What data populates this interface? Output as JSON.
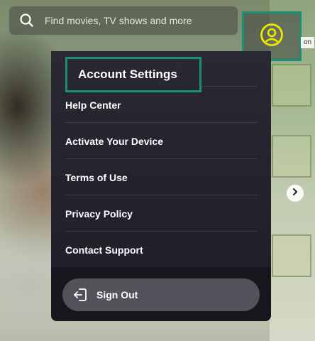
{
  "search": {
    "placeholder": "Find movies, TV shows and more",
    "icon": "search-icon"
  },
  "profile": {
    "icon": "user-circle-icon",
    "accent_color": "#f2e600",
    "focus_color": "#1a8f74"
  },
  "hover_tag": "on",
  "menu": {
    "header_label": "Account Settings",
    "items": [
      {
        "label": "Help Center"
      },
      {
        "label": "Activate Your Device"
      },
      {
        "label": "Terms of Use"
      },
      {
        "label": "Privacy Policy"
      },
      {
        "label": "Contact Support"
      }
    ],
    "sign_out": {
      "label": "Sign Out",
      "icon": "sign-out-icon"
    }
  },
  "carousel": {
    "next_icon": "chevron-right-icon"
  }
}
